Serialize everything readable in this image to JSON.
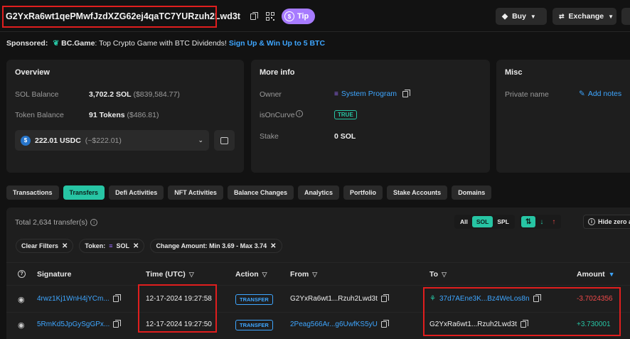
{
  "header": {
    "address": "G2YxRa6wt1qePMwfJzdXZG62ej4qaTC7YURzuh2Lwd3t",
    "tip_label": "Tip",
    "buy_label": "Buy",
    "exchange_label": "Exchange"
  },
  "sponsored": {
    "prefix": "Sponsored:",
    "brand": "BC.Game",
    "text": ": Top Crypto Game with BTC Dividends!",
    "cta": "Sign Up & Win Up to 5 BTC"
  },
  "overview": {
    "title": "Overview",
    "sol_balance_label": "SOL Balance",
    "sol_balance_value": "3,702.2 SOL",
    "sol_balance_usd": "($839,584.77)",
    "token_balance_label": "Token Balance",
    "token_balance_value": "91 Tokens",
    "token_balance_usd": "($486.81)",
    "token_select_value": "222.01 USDC",
    "token_select_usd": "(~$222.01)"
  },
  "more_info": {
    "title": "More info",
    "owner_label": "Owner",
    "owner_value": "System Program",
    "is_on_curve_label": "isOnCurve",
    "is_on_curve_value": "TRUE",
    "stake_label": "Stake",
    "stake_value": "0 SOL"
  },
  "misc": {
    "title": "Misc",
    "private_name_label": "Private name",
    "add_notes_label": "Add notes"
  },
  "tabs": [
    {
      "label": "Transactions",
      "active": false
    },
    {
      "label": "Transfers",
      "active": true
    },
    {
      "label": "Defi Activities",
      "active": false
    },
    {
      "label": "NFT Activities",
      "active": false
    },
    {
      "label": "Balance Changes",
      "active": false
    },
    {
      "label": "Analytics",
      "active": false
    },
    {
      "label": "Portfolio",
      "active": false
    },
    {
      "label": "Stake Accounts",
      "active": false
    },
    {
      "label": "Domains",
      "active": false
    }
  ],
  "transfers": {
    "total_text": "Total 2,634 transfer(s)",
    "type_filters": [
      "All",
      "SOL",
      "SPL"
    ],
    "type_active": "SOL",
    "hide_zero_label": "Hide zero a",
    "filters": {
      "clear_label": "Clear Filters",
      "token_label": "Token:",
      "token_value": "SOL",
      "amount_label": "Change Amount: Min 3.69 - Max 3.74"
    },
    "columns": {
      "signature": "Signature",
      "time": "Time (UTC)",
      "action": "Action",
      "from": "From",
      "to": "To",
      "amount": "Amount"
    },
    "rows": [
      {
        "signature": "4rwz1Kj1WnH4jYCm...",
        "time": "12-17-2024 19:27:58",
        "action": "TRANSFER",
        "from": "G2YxRa6wt1...Rzuh2Lwd3t",
        "to": "37d7AEne3K...Bz4WeLos8n",
        "amount": "-3.7024356"
      },
      {
        "signature": "5RmKd5JpGySgGPx...",
        "time": "12-17-2024 19:27:50",
        "action": "TRANSFER",
        "from": "2Peag566Ar...g6UwfKS5yU",
        "to": "G2YxRa6wt1...Rzuh2Lwd3t",
        "amount": "+3.730001"
      }
    ]
  },
  "colors": {
    "accent": "#27c5a4",
    "link": "#3ea6ff",
    "negative": "#f04a4a",
    "positive": "#27c5a4",
    "tip": "#a77bff",
    "annotation": "#e01e1e"
  }
}
